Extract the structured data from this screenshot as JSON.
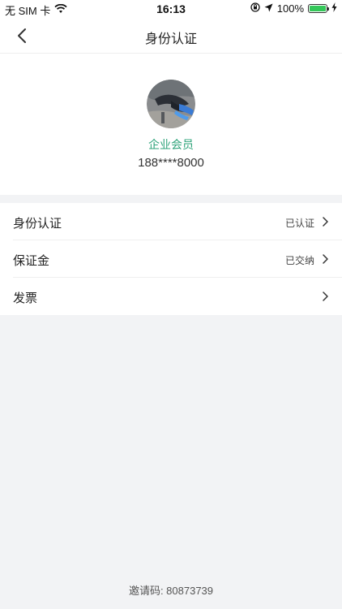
{
  "status_bar": {
    "carrier": "无 SIM 卡",
    "time": "16:13",
    "battery_percent": "100%",
    "battery_level": 1.0
  },
  "nav": {
    "title": "身份认证"
  },
  "profile": {
    "member_type": "企业会员",
    "phone": "188****8000"
  },
  "menu": [
    {
      "label": "身份认证",
      "status": "已认证"
    },
    {
      "label": "保证金",
      "status": "已交纳"
    },
    {
      "label": "发票",
      "status": ""
    }
  ],
  "footer": {
    "invite_code_text": "邀请码: 80873739"
  },
  "colors": {
    "member_green": "#2ea37a",
    "background": "#f2f3f5",
    "battery_green": "#34c759"
  },
  "icons": [
    "back-chevron-icon",
    "wifi-icon",
    "location-arrow-icon",
    "orientation-lock-icon",
    "battery-icon",
    "charging-bolt-icon",
    "chevron-right-icon"
  ]
}
